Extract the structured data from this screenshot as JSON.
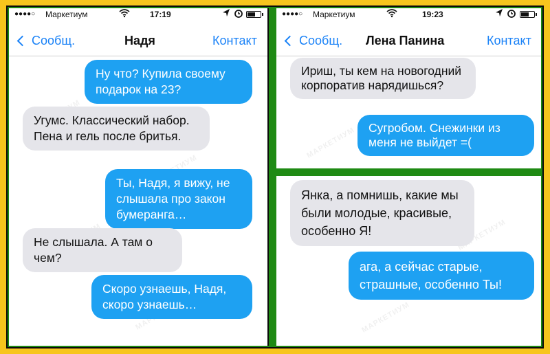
{
  "colors": {
    "background": "#f7c51d",
    "frame": "#1f8a14",
    "ios_blue": "#1a82f7",
    "outgoing_bubble": "#1ea1f2",
    "incoming_bubble": "#e5e5ea"
  },
  "watermark": "МАРКЕТИУМ",
  "screens": [
    {
      "status": {
        "signal_dots": "●●●●○",
        "carrier": "Маркетиум",
        "time": "17:19",
        "icons": [
          "wifi-icon",
          "location-icon",
          "alarm-icon",
          "battery-icon"
        ]
      },
      "nav": {
        "back_label": "Сообщ.",
        "contact_name": "Надя",
        "contact_label": "Контакт"
      },
      "messages": [
        {
          "dir": "out",
          "text": "Ну что? Купила своему подарок на 23?"
        },
        {
          "dir": "in",
          "text": "Угумс. Классический набор. Пена и гель после бритья."
        },
        {
          "dir": "out",
          "text": "Ты, Надя, я вижу, не слышала про закон бумеранга…"
        },
        {
          "dir": "in",
          "text": "Не слышала. А там о чем?"
        },
        {
          "dir": "out",
          "text": "Скоро узнаешь, Надя, скоро узнаешь…"
        }
      ]
    },
    {
      "status": {
        "signal_dots": "●●●●○",
        "carrier": "Маркетиум",
        "time": "19:23",
        "icons": [
          "wifi-icon",
          "location-icon",
          "alarm-icon",
          "battery-icon"
        ]
      },
      "nav": {
        "back_label": "Сообщ.",
        "contact_name": "Лена Панина",
        "contact_label": "Контакт"
      },
      "messages": [
        {
          "dir": "in",
          "text": "Ириш, ты кем на новогодний корпоратив нарядишься?"
        },
        {
          "dir": "out",
          "text": "Сугробом. Снежинки из меня не выйдет =("
        }
      ]
    },
    {
      "messages": [
        {
          "dir": "in",
          "text": "Янка, а помнишь, какие мы были молодые, красивые, особенно Я!"
        },
        {
          "dir": "out",
          "text": "ага, а сейчас старые, страшные, особенно Ты!"
        }
      ]
    }
  ]
}
